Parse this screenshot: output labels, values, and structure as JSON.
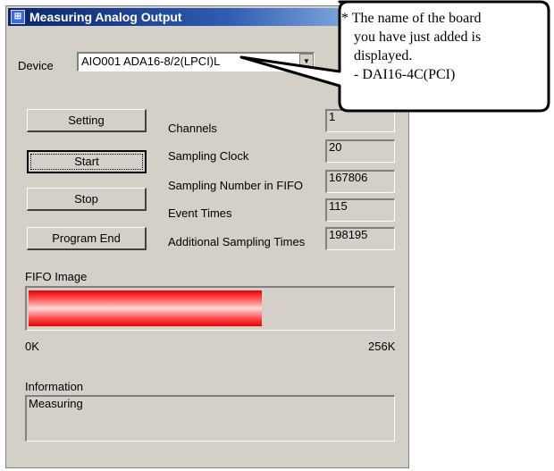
{
  "window": {
    "title": "Measuring Analog Output",
    "title_icon": "app-icon"
  },
  "device": {
    "label": "Device",
    "value": "AIO001 ADA16-8/2(LPCI)L"
  },
  "buttons": {
    "setting": "Setting",
    "start": "Start",
    "stop": "Stop",
    "program_end": "Program End"
  },
  "fields": {
    "channels": {
      "label": "Channels",
      "value": "1"
    },
    "sampling_clock": {
      "label": "Sampling Clock",
      "value": "20"
    },
    "sampling_number": {
      "label": "Sampling Number in FIFO",
      "value": "167806"
    },
    "event_times": {
      "label": "Event Times",
      "value": "115"
    },
    "additional_sampling": {
      "label": "Additional Sampling Times",
      "value": "198195"
    }
  },
  "fifo": {
    "label": "FIFO Image",
    "min": "0K",
    "max": "256K",
    "fill_fraction": 0.64,
    "fill_color": "#e80000"
  },
  "information": {
    "label": "Information",
    "value": "Measuring"
  },
  "callout": {
    "line1": "* The name of the board",
    "line2": "you have just added is",
    "line3": "displayed.",
    "line4": "- DAI16-4C(PCI)"
  }
}
